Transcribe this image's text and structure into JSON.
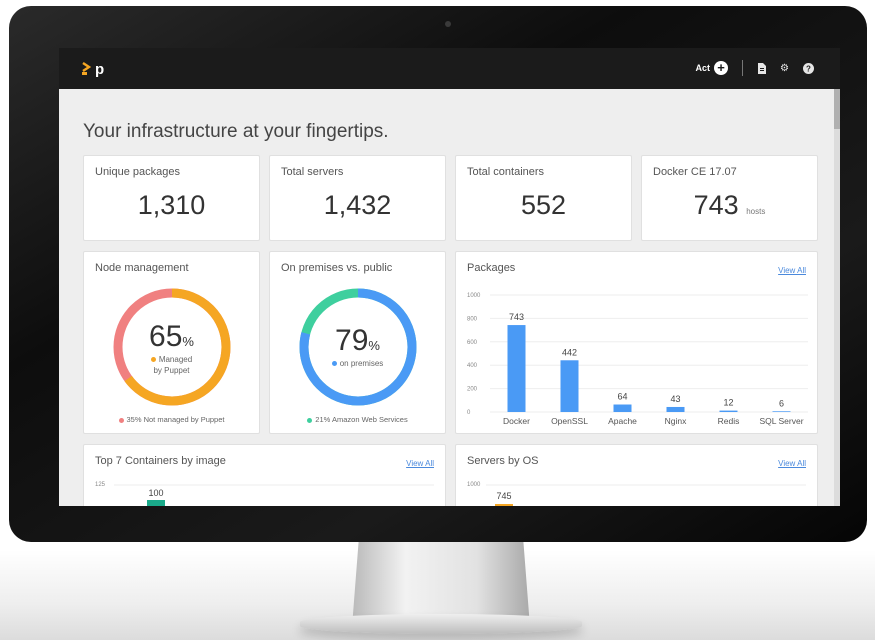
{
  "header": {
    "logo_text": "p",
    "act_label": "Act",
    "icons": [
      "plus-circle-icon",
      "document-icon",
      "gear-icon",
      "help-icon"
    ]
  },
  "page_title": "Your infrastructure at your fingertips.",
  "stats": [
    {
      "label": "Unique packages",
      "value": "1,310",
      "unit": ""
    },
    {
      "label": "Total servers",
      "value": "1,432",
      "unit": ""
    },
    {
      "label": "Total containers",
      "value": "552",
      "unit": ""
    },
    {
      "label": "Docker CE 17.07",
      "value": "743",
      "unit": "hosts"
    }
  ],
  "node_management": {
    "title": "Node management",
    "percent": "65",
    "percent_symbol": "%",
    "center_line1": "Managed",
    "center_line2": "by Puppet",
    "footnote": "35% Not managed by Puppet",
    "managed_fraction": 0.65,
    "colors": {
      "managed": "#f5a623",
      "unmanaged": "#f08080"
    }
  },
  "on_premises": {
    "title": "On premises vs. public",
    "percent": "79",
    "percent_symbol": "%",
    "center_line1": "on premises",
    "footnote": "21% Amazon Web Services",
    "premises_fraction": 0.79,
    "colors": {
      "premises": "#4a9af5",
      "public": "#3ecf9e"
    }
  },
  "packages_chart": {
    "title": "Packages",
    "view_all": "View All",
    "chart_data": {
      "type": "bar",
      "categories": [
        "Docker",
        "OpenSSL",
        "Apache",
        "Nginx",
        "Redis",
        "SQL Server"
      ],
      "values": [
        743,
        442,
        64,
        43,
        12,
        6
      ],
      "ylim": [
        0,
        1000
      ],
      "yticks": [
        "0",
        "200",
        "400",
        "600",
        "800",
        "1000"
      ],
      "grid": true,
      "color": "#4a9af5"
    }
  },
  "containers_chart": {
    "title": "Top 7 Containers by image",
    "view_all": "View All",
    "first_tick": "125",
    "first_value": "100",
    "color": "#1aaa8a"
  },
  "servers_chart": {
    "title": "Servers by OS",
    "view_all": "View All",
    "first_tick": "1000",
    "first_value": "745",
    "color": "#f5a623"
  }
}
